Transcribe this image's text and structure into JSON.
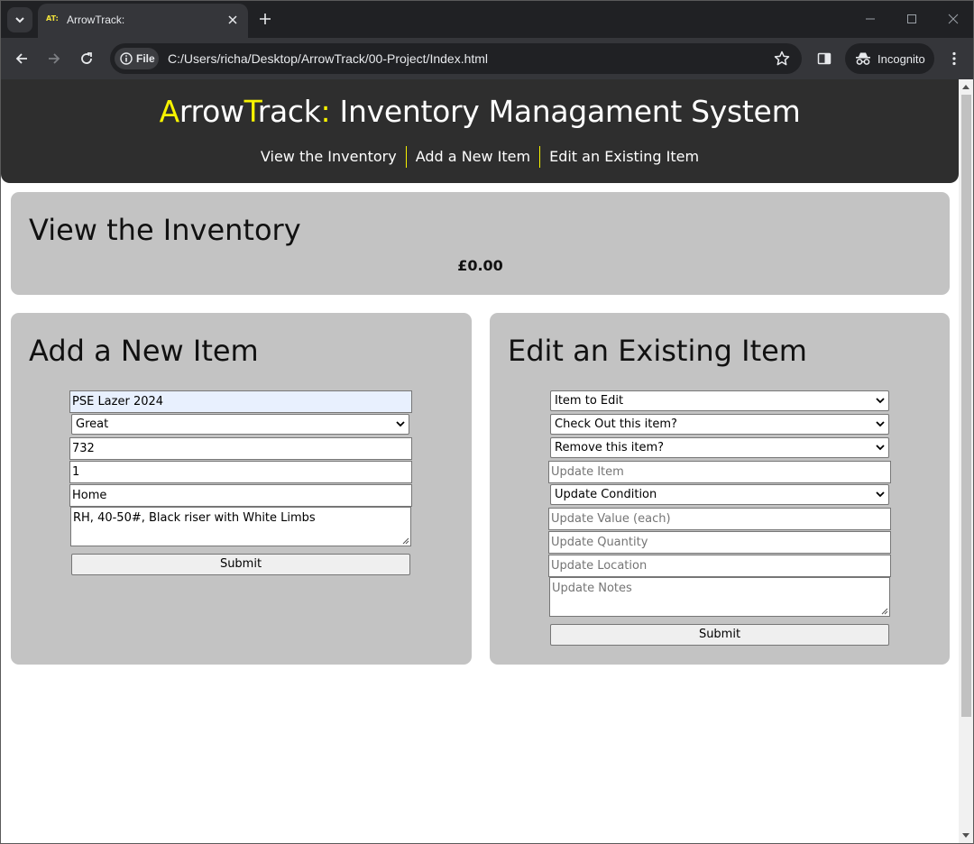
{
  "browser": {
    "tab_favicon_text": "AT:",
    "tab_title": "ArrowTrack:",
    "file_chip_label": "File",
    "url": "C:/Users/richa/Desktop/ArrowTrack/00-Project/Index.html",
    "incognito_label": "Incognito"
  },
  "site": {
    "title_a": "A",
    "title_rrow": "rrow",
    "title_t": "T",
    "title_rack": "rack",
    "title_colon": ":",
    "title_rest": " Inventory Managament System",
    "nav": [
      "View the Inventory",
      "Add a New Item",
      "Edit an Existing Item"
    ],
    "accent_color": "#f7f300",
    "header_color": "#2e2e2e",
    "panel_color": "#c3c3c3"
  },
  "view_inventory": {
    "heading": "View the Inventory",
    "total": "£0.00"
  },
  "add_item": {
    "heading": "Add a New Item",
    "item_name": "PSE Lazer 2024",
    "condition": "Great",
    "value": "732",
    "quantity": "1",
    "location": "Home",
    "notes": "RH, 40-50#, Black riser with White Limbs",
    "submit_label": "Submit"
  },
  "edit_item": {
    "heading": "Edit an Existing Item",
    "item_select": "Item to Edit",
    "checkout_select": "Check Out this item?",
    "remove_select": "Remove this item?",
    "update_item_placeholder": "Update Item",
    "condition_select": "Update Condition",
    "value_placeholder": "Update Value (each)",
    "quantity_placeholder": "Update Quantity",
    "location_placeholder": "Update Location",
    "notes_placeholder": "Update Notes",
    "submit_label": "Submit"
  }
}
